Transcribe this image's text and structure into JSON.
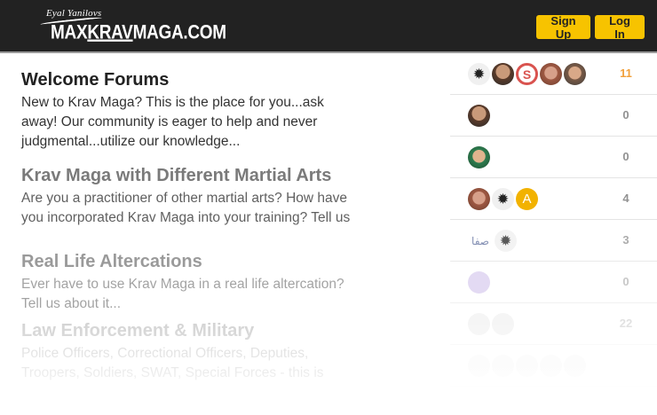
{
  "header": {
    "logo_tagline": "Eyal Yanilovs",
    "logo_prefix": "MAX",
    "logo_krav": "KRAV",
    "logo_suffix": "MAGA.COM",
    "signup_label": "Sign Up",
    "login_label": "Log In",
    "accent_color": "#f7c300"
  },
  "topics": [
    {
      "title": "Welcome Forums",
      "description": "New to Krav Maga? This is the place for you...ask away! Our community is eager to help and never judgmental...utilize our knowledge..."
    },
    {
      "title": "Krav Maga with Different Martial Arts",
      "description": "Are you a practitioner of other martial arts? How have you incorporated Krav Maga into your training? Tell us"
    },
    {
      "title": "Real Life Altercations",
      "description": "Ever have to use Krav Maga in a real life altercation? Tell us about it..."
    },
    {
      "title": "Law Enforcement & Military",
      "description": "Police Officers, Correctional Officers, Deputies, Troopers, Soldiers, SWAT, Special Forces - this is"
    }
  ],
  "rows": [
    {
      "count": "11",
      "avatars": [
        "character-avatar",
        "dark-avatar",
        "s-avatar",
        "photo-avatar",
        "photo-avatar"
      ],
      "s_letter": "S"
    },
    {
      "count": "0",
      "avatars": [
        "dark-avatar"
      ]
    },
    {
      "count": "0",
      "avatars": [
        "photo-avatar"
      ]
    },
    {
      "count": "4",
      "avatars": [
        "photo-avatar",
        "character-avatar",
        "a-avatar"
      ],
      "a_letter": "A"
    },
    {
      "count": "3",
      "avatars": [
        "arabic-avatar",
        "character-avatar"
      ],
      "arabic_text": "صفا"
    },
    {
      "count": "0",
      "avatars": [
        "lavender-avatar"
      ]
    },
    {
      "count": "22",
      "avatars": [
        "ghost-avatar",
        "ghost-avatar"
      ]
    },
    {
      "count": "",
      "avatars": [
        "ghost-avatar",
        "ghost-avatar",
        "ghost-avatar",
        "ghost-avatar",
        "ghost-avatar"
      ]
    }
  ]
}
